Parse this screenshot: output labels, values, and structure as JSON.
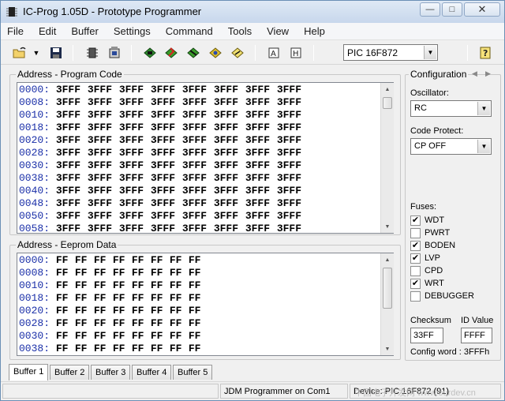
{
  "window": {
    "title": "IC-Prog 1.05D - Prototype Programmer"
  },
  "menu": [
    "File",
    "Edit",
    "Buffer",
    "Settings",
    "Command",
    "Tools",
    "View",
    "Help"
  ],
  "toolbar": {
    "icons": [
      "open-folder-icon",
      "dropdown-arrow-icon",
      "save-icon",
      "chip-icon",
      "cpu-icon",
      "read-icon",
      "program-icon",
      "erase-icon",
      "verify-icon",
      "blank-check-icon",
      "view-icon",
      "assembler-icon",
      "help-icon"
    ],
    "device": "PIC 16F872"
  },
  "program_code": {
    "title": "Address - Program Code",
    "rows": [
      {
        "addr": "0000",
        "values": [
          "3FFF",
          "3FFF",
          "3FFF",
          "3FFF",
          "3FFF",
          "3FFF",
          "3FFF",
          "3FFF"
        ]
      },
      {
        "addr": "0008",
        "values": [
          "3FFF",
          "3FFF",
          "3FFF",
          "3FFF",
          "3FFF",
          "3FFF",
          "3FFF",
          "3FFF"
        ]
      },
      {
        "addr": "0010",
        "values": [
          "3FFF",
          "3FFF",
          "3FFF",
          "3FFF",
          "3FFF",
          "3FFF",
          "3FFF",
          "3FFF"
        ]
      },
      {
        "addr": "0018",
        "values": [
          "3FFF",
          "3FFF",
          "3FFF",
          "3FFF",
          "3FFF",
          "3FFF",
          "3FFF",
          "3FFF"
        ]
      },
      {
        "addr": "0020",
        "values": [
          "3FFF",
          "3FFF",
          "3FFF",
          "3FFF",
          "3FFF",
          "3FFF",
          "3FFF",
          "3FFF"
        ]
      },
      {
        "addr": "0028",
        "values": [
          "3FFF",
          "3FFF",
          "3FFF",
          "3FFF",
          "3FFF",
          "3FFF",
          "3FFF",
          "3FFF"
        ]
      },
      {
        "addr": "0030",
        "values": [
          "3FFF",
          "3FFF",
          "3FFF",
          "3FFF",
          "3FFF",
          "3FFF",
          "3FFF",
          "3FFF"
        ]
      },
      {
        "addr": "0038",
        "values": [
          "3FFF",
          "3FFF",
          "3FFF",
          "3FFF",
          "3FFF",
          "3FFF",
          "3FFF",
          "3FFF"
        ]
      },
      {
        "addr": "0040",
        "values": [
          "3FFF",
          "3FFF",
          "3FFF",
          "3FFF",
          "3FFF",
          "3FFF",
          "3FFF",
          "3FFF"
        ]
      },
      {
        "addr": "0048",
        "values": [
          "3FFF",
          "3FFF",
          "3FFF",
          "3FFF",
          "3FFF",
          "3FFF",
          "3FFF",
          "3FFF"
        ]
      },
      {
        "addr": "0050",
        "values": [
          "3FFF",
          "3FFF",
          "3FFF",
          "3FFF",
          "3FFF",
          "3FFF",
          "3FFF",
          "3FFF"
        ]
      },
      {
        "addr": "0058",
        "values": [
          "3FFF",
          "3FFF",
          "3FFF",
          "3FFF",
          "3FFF",
          "3FFF",
          "3FFF",
          "3FFF"
        ]
      }
    ]
  },
  "eeprom": {
    "title": "Address - Eeprom Data",
    "rows": [
      {
        "addr": "0000",
        "values": [
          "FF",
          "FF",
          "FF",
          "FF",
          "FF",
          "FF",
          "FF",
          "FF"
        ]
      },
      {
        "addr": "0008",
        "values": [
          "FF",
          "FF",
          "FF",
          "FF",
          "FF",
          "FF",
          "FF",
          "FF"
        ]
      },
      {
        "addr": "0010",
        "values": [
          "FF",
          "FF",
          "FF",
          "FF",
          "FF",
          "FF",
          "FF",
          "FF"
        ]
      },
      {
        "addr": "0018",
        "values": [
          "FF",
          "FF",
          "FF",
          "FF",
          "FF",
          "FF",
          "FF",
          "FF"
        ]
      },
      {
        "addr": "0020",
        "values": [
          "FF",
          "FF",
          "FF",
          "FF",
          "FF",
          "FF",
          "FF",
          "FF"
        ]
      },
      {
        "addr": "0028",
        "values": [
          "FF",
          "FF",
          "FF",
          "FF",
          "FF",
          "FF",
          "FF",
          "FF"
        ]
      },
      {
        "addr": "0030",
        "values": [
          "FF",
          "FF",
          "FF",
          "FF",
          "FF",
          "FF",
          "FF",
          "FF"
        ]
      },
      {
        "addr": "0038",
        "values": [
          "FF",
          "FF",
          "FF",
          "FF",
          "FF",
          "FF",
          "FF",
          "FF"
        ]
      }
    ]
  },
  "config": {
    "title": "Configuration",
    "oscillator_label": "Oscillator:",
    "oscillator": "RC",
    "code_protect_label": "Code Protect:",
    "code_protect": "CP OFF",
    "fuses_label": "Fuses:",
    "fuses": [
      {
        "name": "WDT",
        "checked": true
      },
      {
        "name": "PWRT",
        "checked": false
      },
      {
        "name": "BODEN",
        "checked": true
      },
      {
        "name": "LVP",
        "checked": true
      },
      {
        "name": "CPD",
        "checked": false
      },
      {
        "name": "WRT",
        "checked": true
      },
      {
        "name": "DEBUGGER",
        "checked": false
      }
    ],
    "checksum_label": "Checksum",
    "checksum": "33FF",
    "id_label": "ID Value",
    "id_value": "FFFF",
    "config_word": "Config word : 3FFFh"
  },
  "tabs": [
    "Buffer 1",
    "Buffer 2",
    "Buffer 3",
    "Buffer 4",
    "Buffer 5"
  ],
  "status": {
    "programmer": "JDM Programmer on Com1",
    "device": "Device: PIC 16F872  (91)"
  },
  "watermark": "中国电子开发网 www.ourdev.cn"
}
